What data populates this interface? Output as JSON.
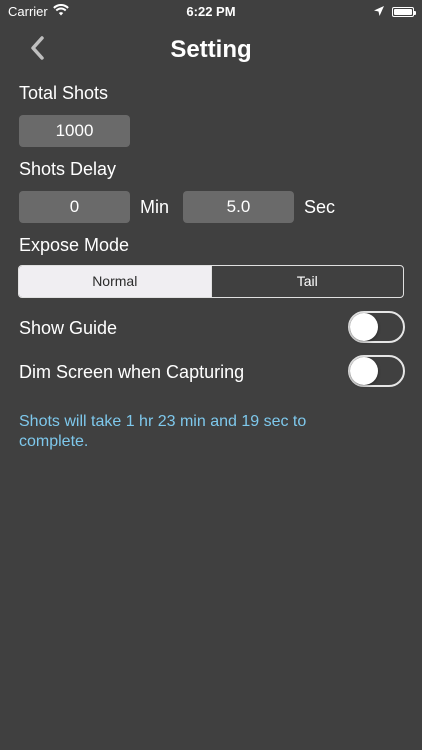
{
  "status_bar": {
    "carrier": "Carrier",
    "time": "6:22 PM",
    "icons": [
      "wifi-icon",
      "location-arrow-icon",
      "battery-icon"
    ]
  },
  "nav": {
    "back_icon": "chevron-left-icon",
    "title": "Setting"
  },
  "total_shots": {
    "label": "Total Shots",
    "value": "1000"
  },
  "shots_delay": {
    "label": "Shots Delay",
    "min_value": "0",
    "min_unit": "Min",
    "sec_value": "5.0",
    "sec_unit": "Sec"
  },
  "expose_mode": {
    "label": "Expose Mode",
    "options": [
      "Normal",
      "Tail"
    ],
    "selected": "Normal"
  },
  "show_guide": {
    "label": "Show Guide",
    "on": false
  },
  "dim_screen": {
    "label": "Dim Screen when Capturing",
    "on": false
  },
  "info": "Shots will take 1 hr 23 min and 19 sec to complete.",
  "colors": {
    "background": "#404040",
    "field": "#6a6a6a",
    "info_text": "#7ec8ec",
    "segment_selected": "#f0eef2"
  }
}
